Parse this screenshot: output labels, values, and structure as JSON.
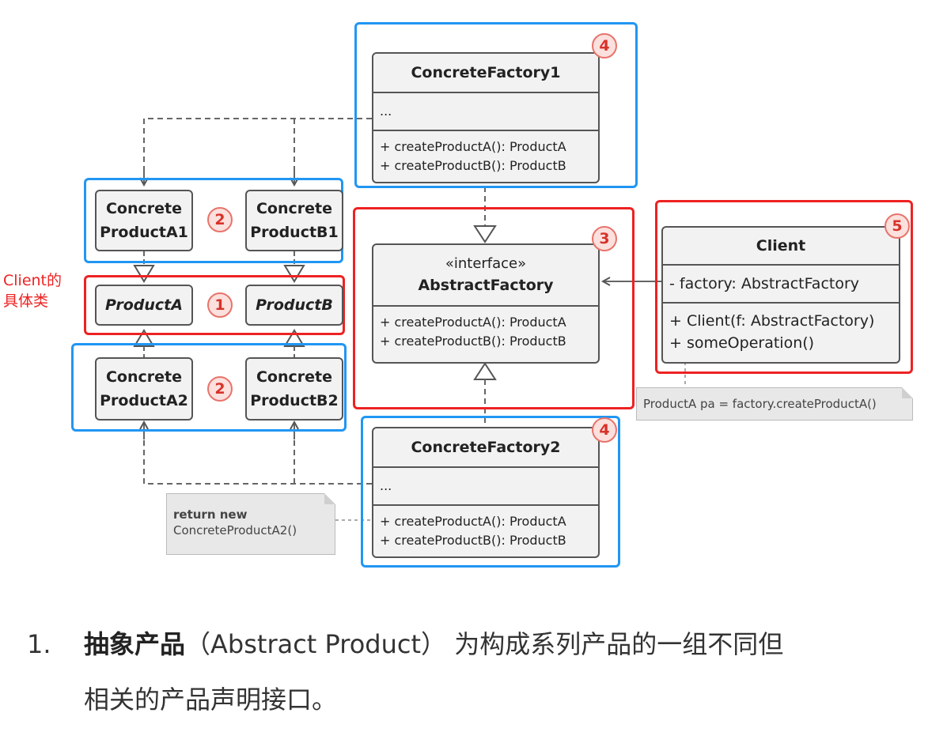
{
  "labels": {
    "client_concrete": [
      "Client的",
      "具体类"
    ]
  },
  "boxes": {
    "concrete_factory1": {
      "title": "ConcreteFactory1",
      "fields": "...",
      "methods": [
        "+ createProductA(): ProductA",
        "+ createProductB(): ProductB"
      ]
    },
    "concrete_factory2": {
      "title": "ConcreteFactory2",
      "fields": "...",
      "methods": [
        "+ createProductA(): ProductA",
        "+ createProductB(): ProductB"
      ]
    },
    "abstract_factory": {
      "stereotype": "«interface»",
      "title": "AbstractFactory",
      "methods": [
        "+ createProductA(): ProductA",
        "+ createProductB(): ProductB"
      ]
    },
    "client": {
      "title": "Client",
      "fields": "- factory: AbstractFactory",
      "methods": [
        "+ Client(f: AbstractFactory)",
        "+ someOperation()"
      ]
    },
    "concrete_product_a1": [
      "Concrete",
      "ProductA1"
    ],
    "concrete_product_b1": [
      "Concrete",
      "ProductB1"
    ],
    "product_a": "ProductA",
    "product_b": "ProductB",
    "concrete_product_a2": [
      "Concrete",
      "ProductA2"
    ],
    "concrete_product_b2": [
      "Concrete",
      "ProductB2"
    ]
  },
  "badges": {
    "cf1": "4",
    "cp1": "2",
    "prod": "1",
    "cp2": "2",
    "af": "3",
    "client": "5",
    "cf2": "4"
  },
  "notes": {
    "client_note": "ProductA pa = factory.createProductA()",
    "factory_note": {
      "bold": "return new",
      "text": "ConcreteProductA2()"
    }
  },
  "description": {
    "number": "1.",
    "bold": "抽象产品",
    "line1_rest": "（Abstract Product） 为构成系列产品的一组不同但",
    "line2": "相关的产品声明接口。"
  }
}
